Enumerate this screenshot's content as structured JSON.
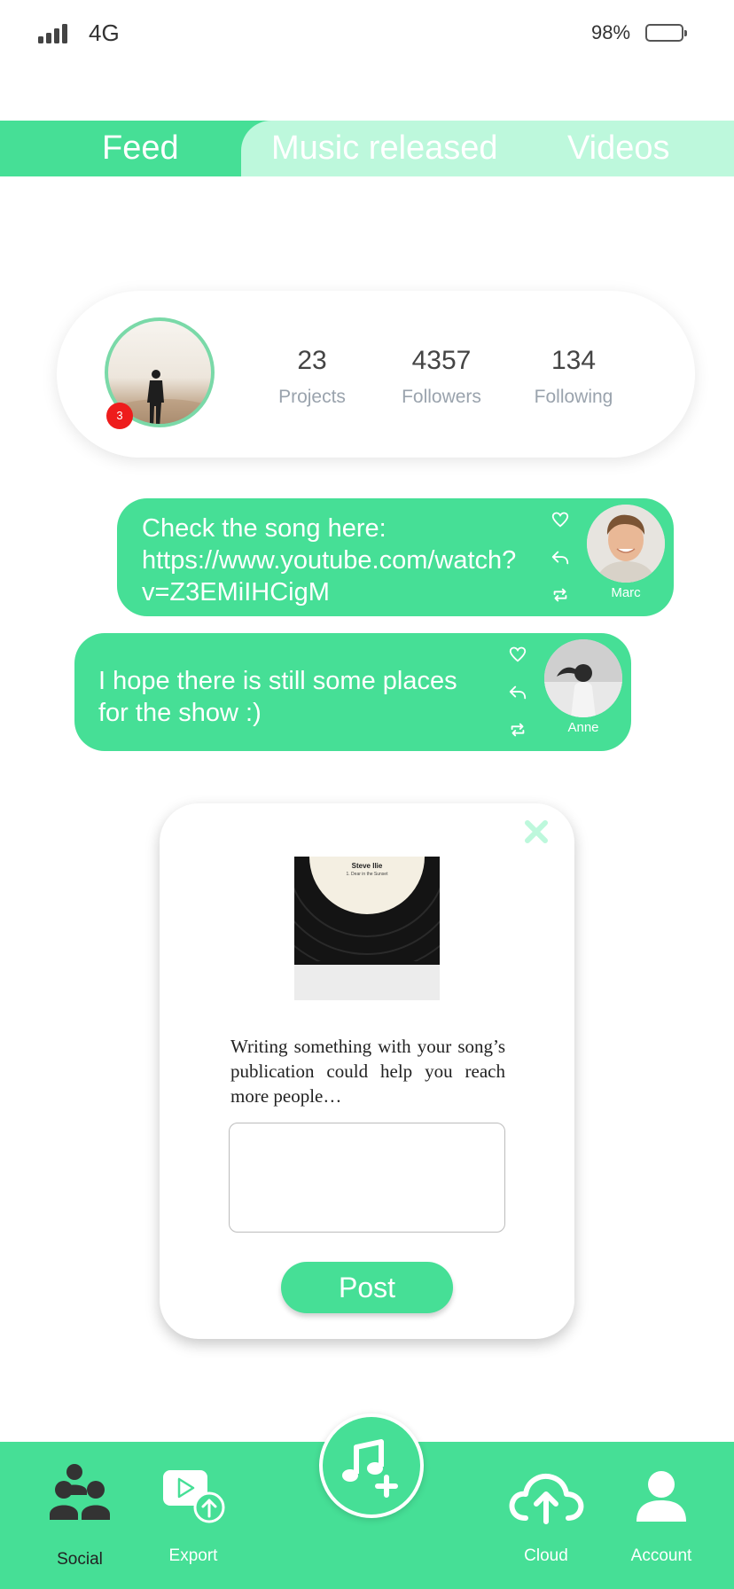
{
  "status_bar": {
    "network": "4G",
    "battery": "98%"
  },
  "tabs": [
    {
      "label": "Feed",
      "active": true
    },
    {
      "label": "Music released",
      "active": false
    },
    {
      "label": "Videos",
      "active": false
    }
  ],
  "profile": {
    "notification_count": "3",
    "stats": [
      {
        "value": "23",
        "label": "Projects"
      },
      {
        "value": "4357",
        "label": "Followers"
      },
      {
        "value": "134",
        "label": "Following"
      }
    ]
  },
  "messages": [
    {
      "text": "Check the song here:\nhttps://www.youtube.com/watch?\nv=Z3EMiIHCigM",
      "author": "Marc"
    },
    {
      "text": "I hope there is still some places\nfor the show :)",
      "author": "Anne"
    }
  ],
  "modal": {
    "album_title": "Steve Ilie",
    "album_subtitle": "1. Dear in the Sunset",
    "message": "Writing something with your song’s publication could help you reach more people…",
    "input_value": "",
    "post_label": "Post"
  },
  "bottom_nav": [
    {
      "label": "Social",
      "icon": "people-icon",
      "active": true
    },
    {
      "label": "Export",
      "icon": "export-icon",
      "active": false
    },
    {
      "label": "Cloud",
      "icon": "cloud-upload-icon",
      "active": false
    },
    {
      "label": "Account",
      "icon": "person-icon",
      "active": false
    }
  ],
  "colors": {
    "accent": "#46df96",
    "tab_inactive_bg": "#bdf8dc",
    "badge": "#ee1c1c"
  }
}
